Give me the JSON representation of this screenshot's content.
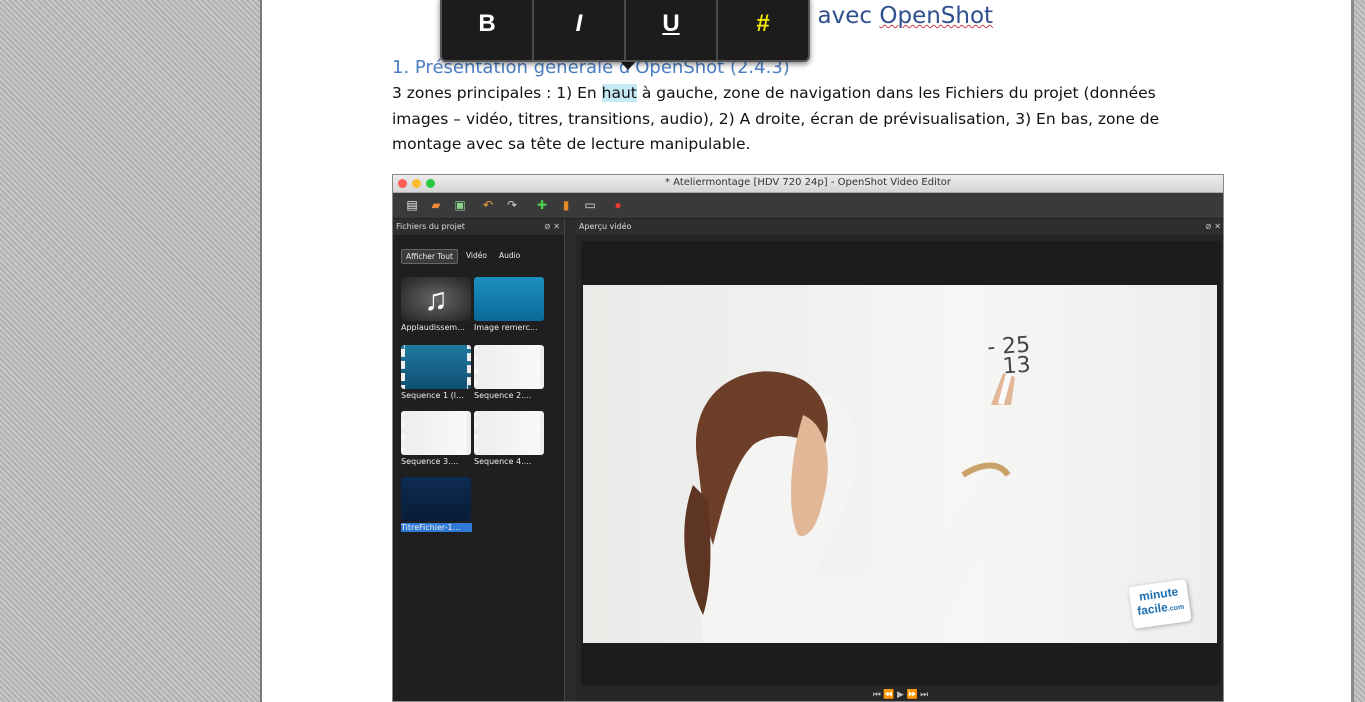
{
  "document": {
    "title_visible": "éo avec OpenShot",
    "title_pre": "éo avec ",
    "title_word": "OpenShot",
    "section_heading": "1. Présentation générale d'OpenShot (2.4.3)",
    "body_before_highlight": "3 zones principales : 1) En ",
    "body_highlight": "haut",
    "body_after_highlight": " à gauche, zone de navigation dans les Fichiers du projet (données images – vidéo, titres, transitions, audio), 2) A droite, écran de prévisualisation, 3) En bas, zone de montage avec sa tête de lecture manipulable."
  },
  "format_toolbar": {
    "bold": "B",
    "italic": "I",
    "underline": "U",
    "hash": "#"
  },
  "embedded_screenshot": {
    "window_title": "* Ateliermontage [HDV 720 24p] - OpenShot Video Editor",
    "left_panel_title": "Fichiers du projet",
    "right_panel_title": "Aperçu vidéo",
    "panel_controls": "⊘ ✕",
    "filter_tabs": [
      "Afficher Tout",
      "Vidéo",
      "Audio"
    ],
    "files": [
      {
        "label": "Applaudissem..."
      },
      {
        "label": "Image remerc..."
      },
      {
        "label": "Sequence 1 (l..."
      },
      {
        "label": "Sequence 2...."
      },
      {
        "label": "Sequence 3...."
      },
      {
        "label": "Sequence 4...."
      },
      {
        "label": "TitreFichier-1..."
      }
    ],
    "logo_line1": "minute",
    "logo_line2": "facile",
    "logo_suffix": ".com",
    "board_text": "- 25\n  13",
    "player_controls": "⏮ ⏪ ▶ ⏩ ⏭"
  }
}
